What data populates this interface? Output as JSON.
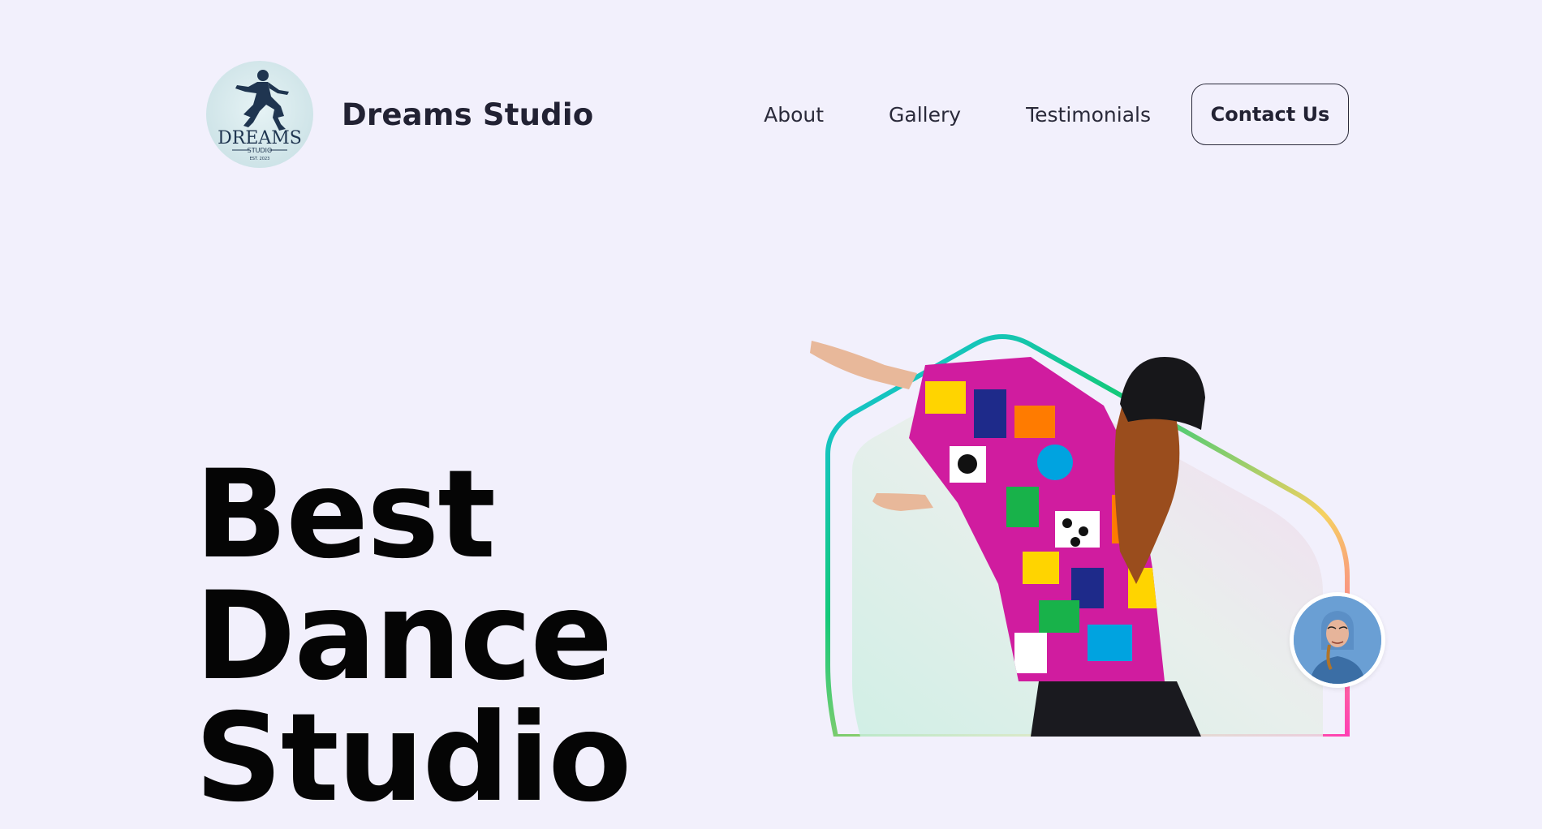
{
  "brand": {
    "name": "Dreams Studio",
    "logo_text": "DREAMS",
    "logo_subtext": "STUDIO",
    "logo_tagline": "EST. 2023"
  },
  "nav": {
    "items": [
      {
        "label": "About"
      },
      {
        "label": "Gallery"
      },
      {
        "label": "Testimonials"
      }
    ],
    "contact_label": "Contact Us"
  },
  "hero": {
    "title_lines": [
      "Best",
      "Dance",
      "Studio"
    ]
  },
  "colors": {
    "background": "#f2f0fc",
    "frame_gradient": [
      "#16c2e8",
      "#14c97a",
      "#f6d160",
      "#ff3fb4"
    ],
    "text": "#050505"
  }
}
